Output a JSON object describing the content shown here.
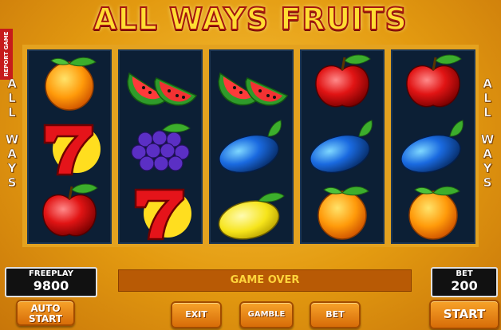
{
  "title": "ALL WAYS FRUITS",
  "report_tab": "REPORT GAME",
  "side_left": [
    "A",
    "L",
    "L",
    "",
    "W",
    "A",
    "Y",
    "S"
  ],
  "side_right": [
    "A",
    "L",
    "L",
    "",
    "W",
    "A",
    "Y",
    "S"
  ],
  "reels": [
    [
      "orange",
      "seven",
      "cherry-apple"
    ],
    [
      "watermelon",
      "grapes",
      "seven"
    ],
    [
      "watermelon",
      "plum",
      "lemon"
    ],
    [
      "cherry-apple",
      "plum",
      "orange"
    ],
    [
      "cherry-apple",
      "plum",
      "orange"
    ]
  ],
  "freeplay": {
    "label": "FREEPLAY",
    "value": "9800"
  },
  "bet": {
    "label": "BET",
    "value": "200"
  },
  "message": "GAME OVER",
  "buttons": {
    "auto_start_1": "AUTO",
    "auto_start_2": "START",
    "exit": "EXIT",
    "gamble": "GAMBLE",
    "bet": "BET",
    "start": "START"
  },
  "colors": {
    "background": "#e39a10",
    "reel_bg": "#0c1f35",
    "title_fill": "#ffdd33",
    "title_stroke": "#a5160e",
    "message_text": "#ffd43b",
    "button": "#e8890f"
  }
}
